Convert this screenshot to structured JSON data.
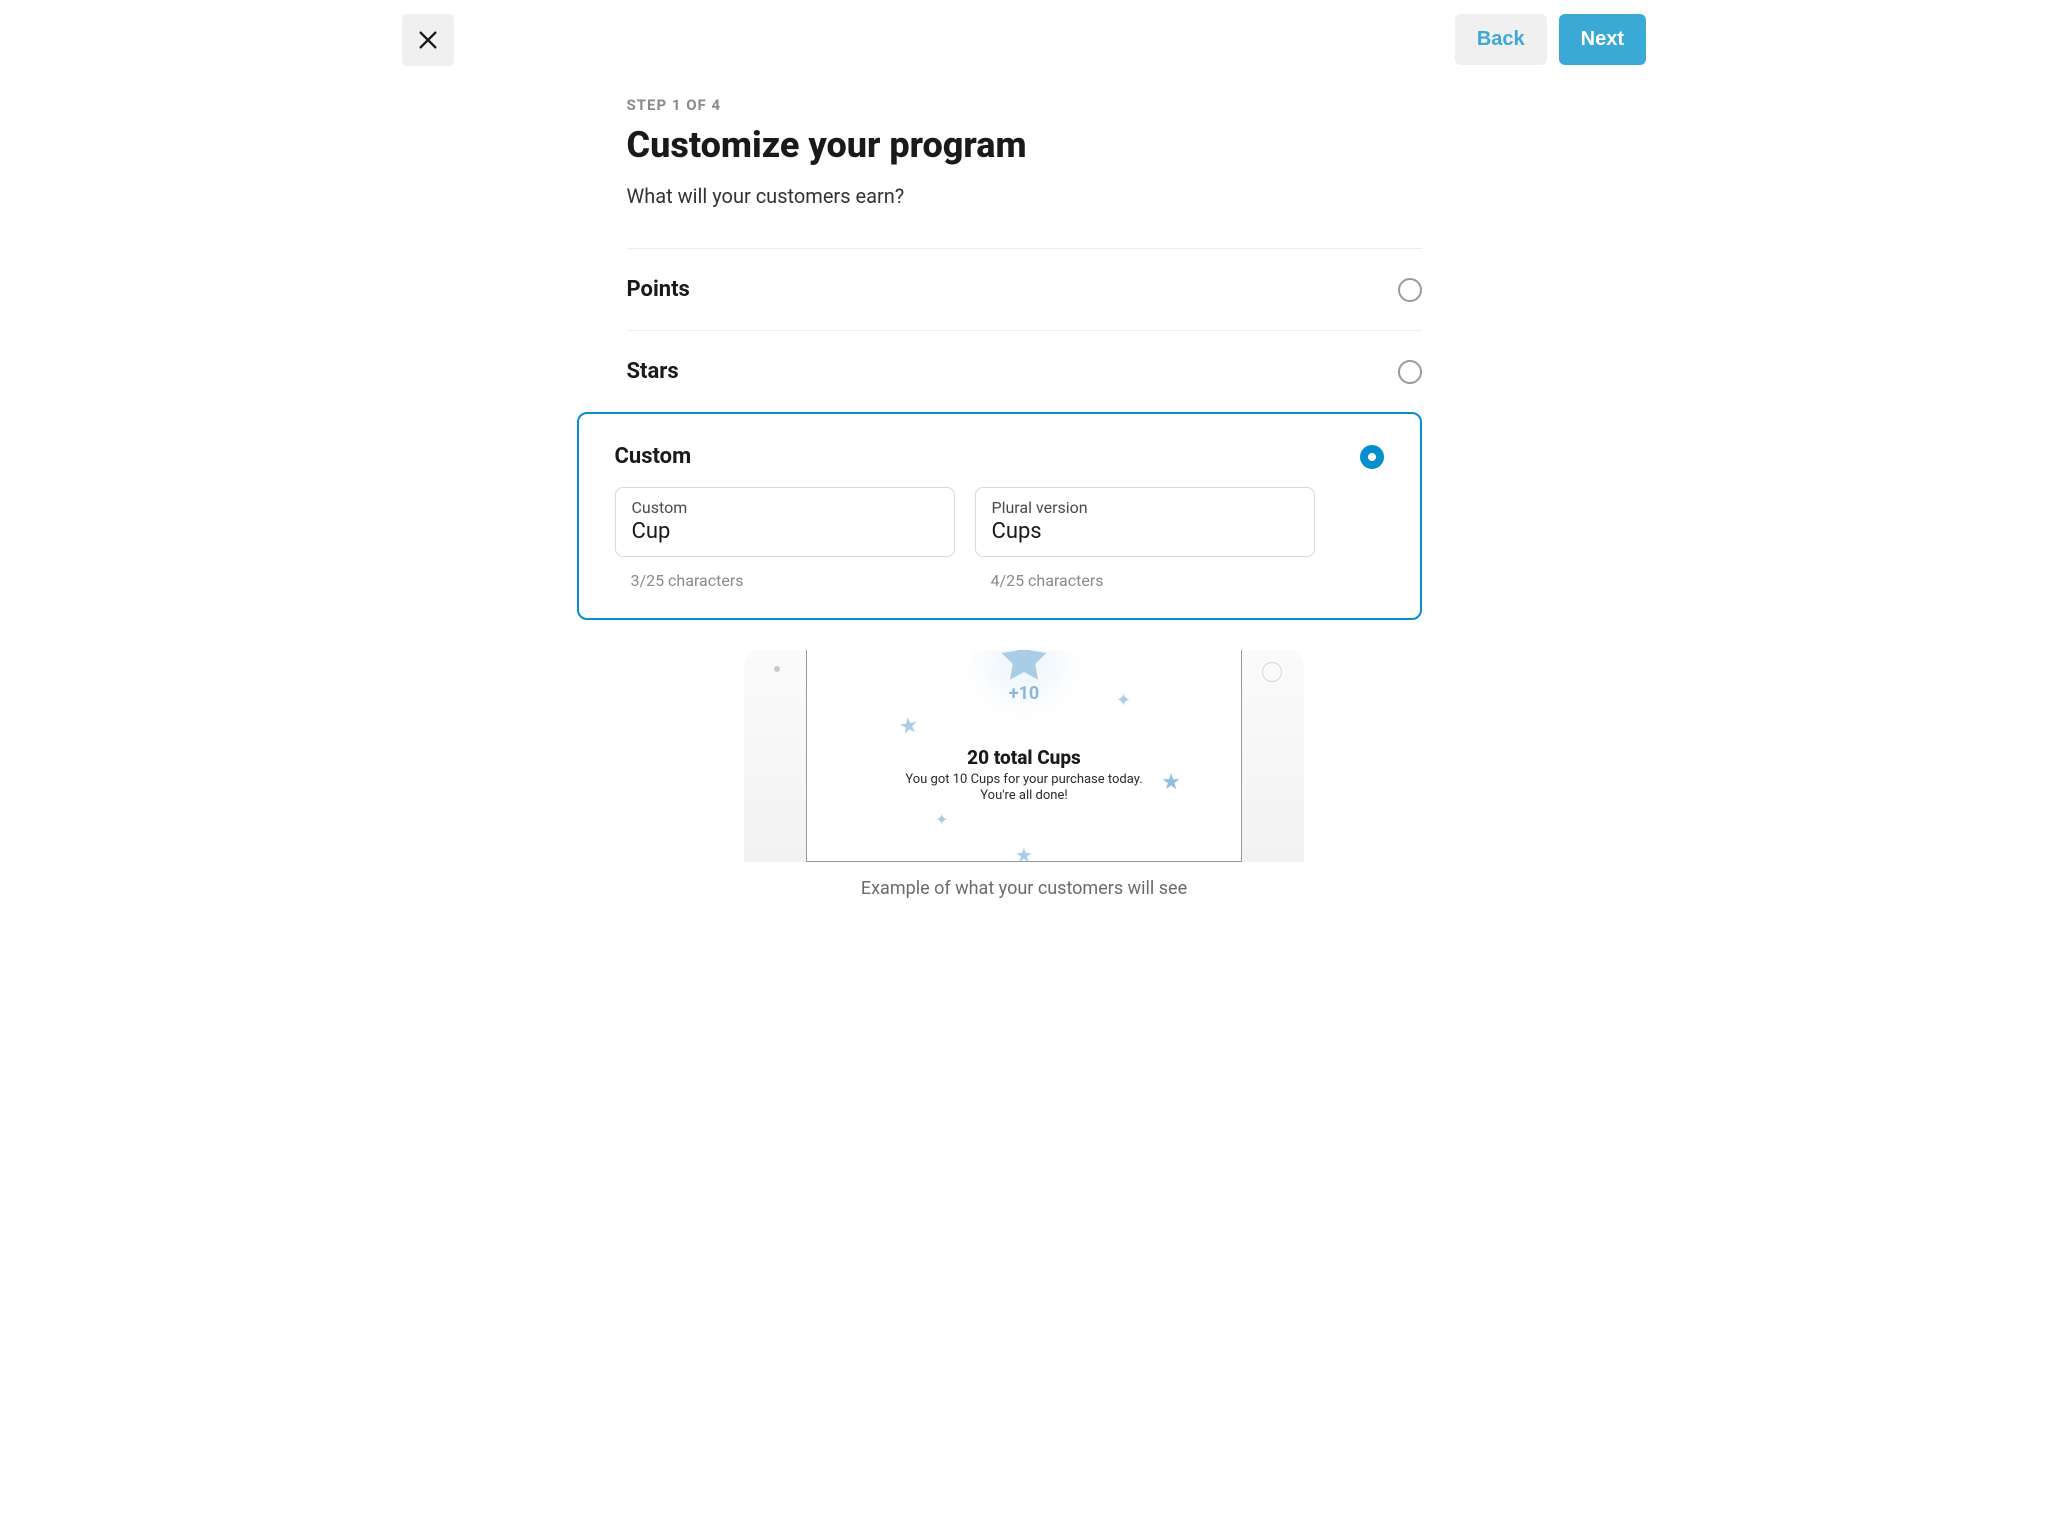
{
  "header": {
    "back_label": "Back",
    "next_label": "Next"
  },
  "step_label": "STEP 1 OF 4",
  "title": "Customize your program",
  "subtitle": "What will your customers earn?",
  "options": {
    "points": {
      "label": "Points",
      "selected": false
    },
    "stars": {
      "label": "Stars",
      "selected": false
    },
    "custom": {
      "label": "Custom",
      "selected": true
    }
  },
  "custom_fields": {
    "singular": {
      "label": "Custom",
      "value": "Cup",
      "char_count": "3/25 characters"
    },
    "plural": {
      "label": "Plural version",
      "value": "Cups",
      "char_count": "4/25 characters"
    }
  },
  "preview": {
    "burst_label": "+10",
    "title": "20 total Cups",
    "line1": "You got 10 Cups for your purchase today.",
    "line2": "You're all done!",
    "caption": "Example of what your customers will see"
  }
}
